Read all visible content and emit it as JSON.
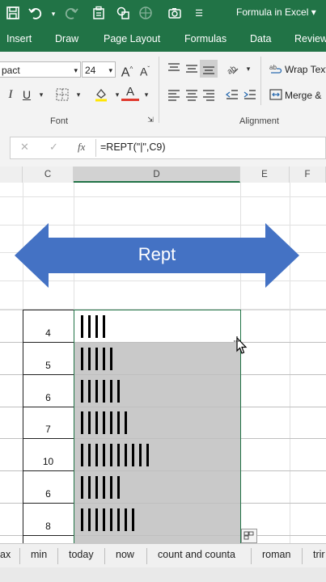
{
  "window": {
    "title": "Formula in Excel ▾"
  },
  "quick_access": {
    "icons": [
      "save-icon",
      "undo-icon",
      "redo-icon",
      "form-icon",
      "shapes-icon",
      "camera-icon",
      "more-icon"
    ]
  },
  "ribbon_tabs": [
    "Insert",
    "Draw",
    "Page Layout",
    "Formulas",
    "Data",
    "Review"
  ],
  "ribbon": {
    "font_name": "pact",
    "font_size": "24",
    "font_group_label": "Font",
    "alignment_group_label": "Alignment",
    "wrap_text_label": "Wrap Text",
    "merge_label": "Merge &",
    "italic_label": "I",
    "underline_label": "U",
    "grow_font_label": "A",
    "shrink_font_label": "A",
    "font_color_label": "A",
    "colors": {
      "accent": "#217346",
      "font_color_bar": "#e03a2e",
      "fill_color_bar": "#ffe600"
    }
  },
  "formula_bar": {
    "cancel": "✕",
    "enter": "✓",
    "fx": "fx",
    "formula": "=REPT(\"|\",C9)"
  },
  "columns": [
    "C",
    "D",
    "E",
    "F"
  ],
  "shape": {
    "text": "Rept",
    "color": "#4472c4"
  },
  "rows": [
    {
      "c": "4",
      "bars": 4
    },
    {
      "c": "5",
      "bars": 5
    },
    {
      "c": "6",
      "bars": 6
    },
    {
      "c": "7",
      "bars": 7
    },
    {
      "c": "10",
      "bars": 10
    },
    {
      "c": "6",
      "bars": 6
    },
    {
      "c": "8",
      "bars": 8
    }
  ],
  "sheet_tabs": [
    "ax",
    "min",
    "today",
    "now",
    "count and counta",
    "roman",
    "trir"
  ]
}
